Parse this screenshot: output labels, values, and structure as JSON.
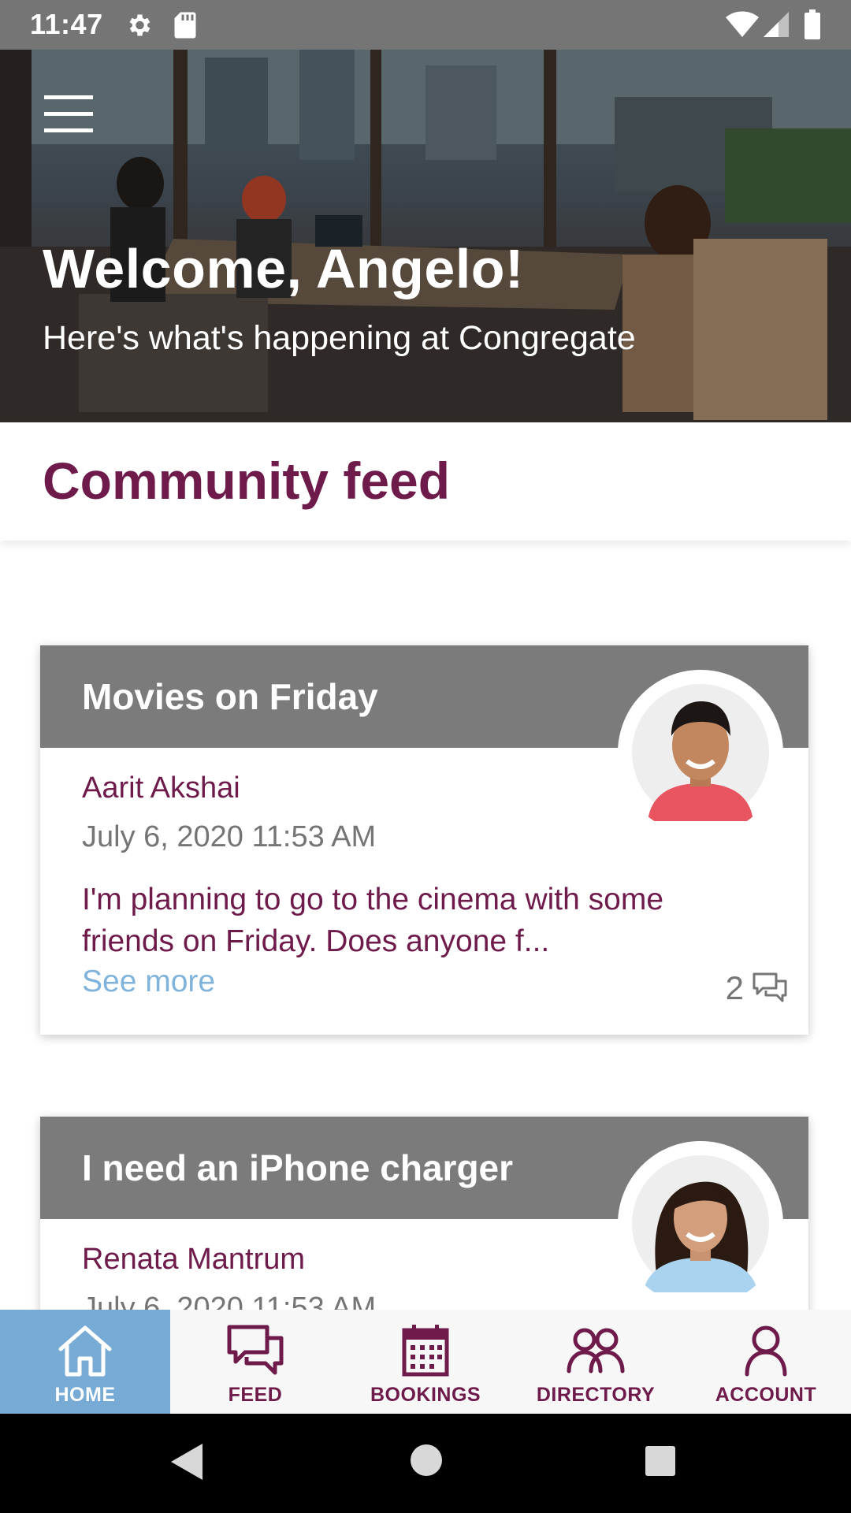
{
  "status_bar": {
    "time": "11:47"
  },
  "hero": {
    "title": "Welcome, Angelo!",
    "subtitle": "Here's what's happening at Congregate"
  },
  "section": {
    "title": "Community feed"
  },
  "feed": {
    "posts": [
      {
        "title": "Movies on Friday",
        "author": "Aarit Akshai",
        "date": "July 6, 2020 11:53 AM",
        "body": "I'm planning to go to the cinema with some friends on Friday. Does anyone f...",
        "see_more": "See more",
        "comment_count": "2"
      },
      {
        "title": "I need an iPhone charger",
        "author": "Renata Mantrum",
        "date": "July 6, 2020 11:53 AM"
      }
    ]
  },
  "bottom_nav": {
    "items": [
      {
        "label": "HOME",
        "icon": "home-icon",
        "active": true
      },
      {
        "label": "FEED",
        "icon": "chat-icon",
        "active": false
      },
      {
        "label": "BOOKINGS",
        "icon": "calendar-icon",
        "active": false
      },
      {
        "label": "DIRECTORY",
        "icon": "people-icon",
        "active": false
      },
      {
        "label": "ACCOUNT",
        "icon": "person-icon",
        "active": false
      }
    ]
  },
  "colors": {
    "brand": "#6e1b4b",
    "accent": "#77abd6",
    "link": "#7fb3dc",
    "card_header": "#7b7b7b"
  }
}
